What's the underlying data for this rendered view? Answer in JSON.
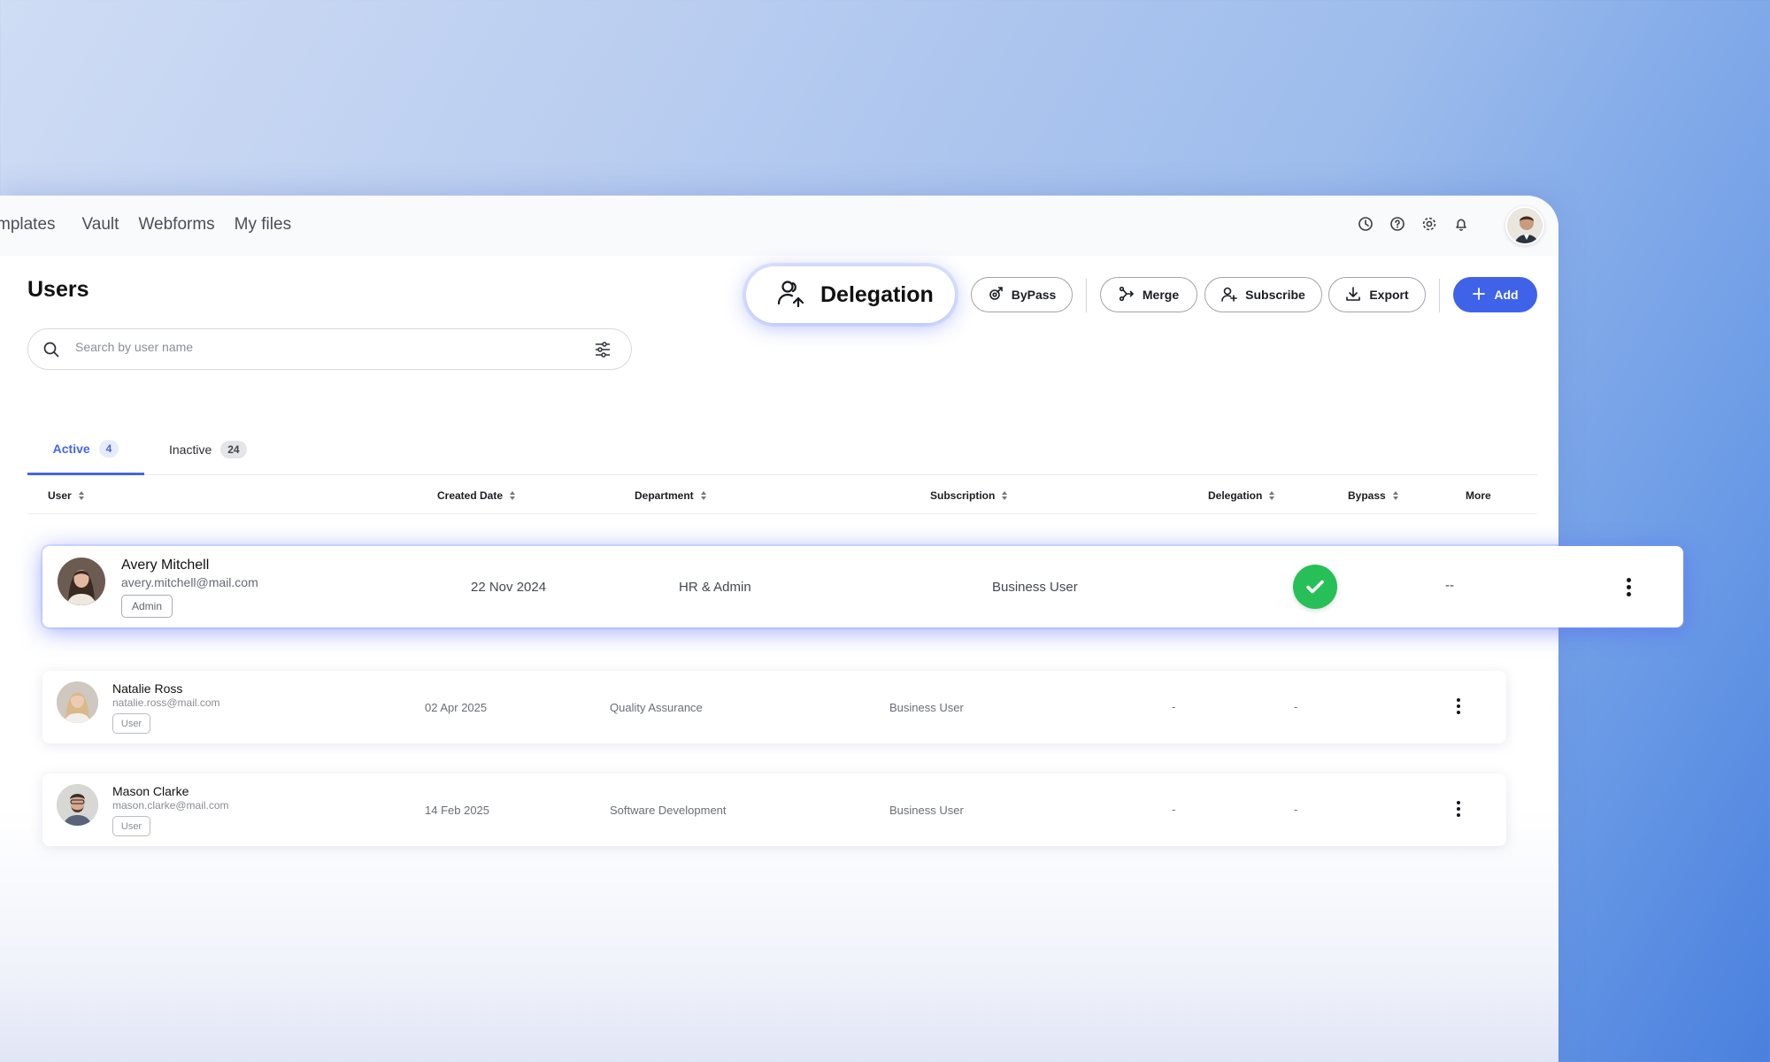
{
  "nav": {
    "items": [
      "mplates",
      "Vault",
      "Webforms",
      "My files"
    ]
  },
  "top_icons": [
    "history-icon",
    "help-icon",
    "settings-icon",
    "bell-icon"
  ],
  "page": {
    "title": "Users"
  },
  "search": {
    "placeholder": "Search by user name",
    "value": ""
  },
  "toolbar": {
    "delegation_label": "Delegation",
    "bypass_label": "ByPass",
    "merge_label": "Merge",
    "subscribe_label": "Subscribe",
    "export_label": "Export",
    "add_label": "Add"
  },
  "tabs": [
    {
      "label": "Active",
      "count": "4",
      "active": true
    },
    {
      "label": "Inactive",
      "count": "24",
      "active": false
    }
  ],
  "columns": [
    "User",
    "Created Date",
    "Department",
    "Subscription",
    "Delegation",
    "Bypass",
    "More"
  ],
  "rows": [
    {
      "name": "Avery Mitchell",
      "email": "avery.mitchell@mail.com",
      "role": "Admin",
      "created": "22 Nov 2024",
      "department": "HR & Admin",
      "subscription": "Business User",
      "delegation": "check",
      "bypass": "--"
    },
    {
      "name": "Natalie Ross",
      "email": "natalie.ross@mail.com",
      "role": "User",
      "created": "02 Apr 2025",
      "department": "Quality Assurance",
      "subscription": "Business User",
      "delegation": "-",
      "bypass": "-"
    },
    {
      "name": "Mason Clarke",
      "email": "mason.clarke@mail.com",
      "role": "User",
      "created": "14 Feb 2025",
      "department": "Software Development",
      "subscription": "Business User",
      "delegation": "-",
      "bypass": "-"
    }
  ],
  "colors": {
    "accent": "#3f63e8",
    "success": "#27c058",
    "tab_active": "#4666e0"
  }
}
